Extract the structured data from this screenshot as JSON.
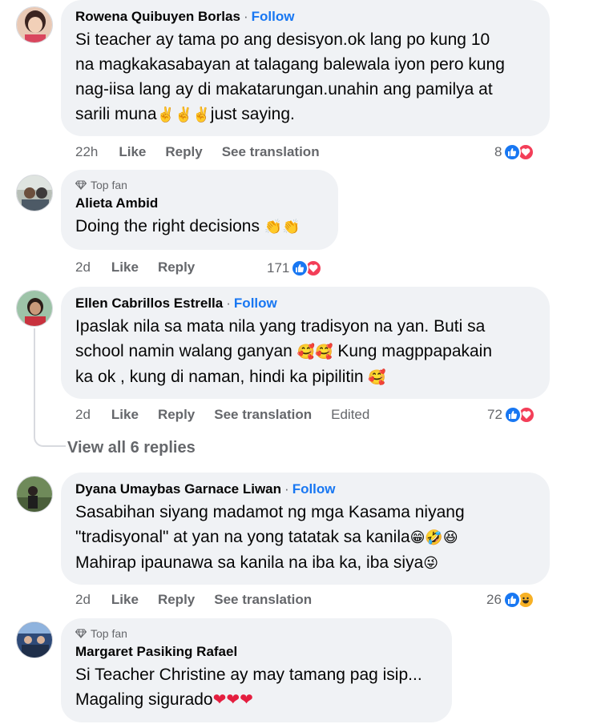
{
  "comments": [
    {
      "name": "Rowena Quibuyen Borlas",
      "follow": "Follow",
      "top_fan": "",
      "lines": [
        "Si teacher ay tama po ang desisyon.ok lang po kung 10",
        "na magkakasabayan at talagang balewala iyon pero kung",
        "nag-iisa lang ay di makatarungan.unahin ang pamilya at",
        "sarili muna"
      ],
      "text_suffix": "just saying.",
      "time": "22h",
      "like": "Like",
      "reply": "Reply",
      "translate": "See translation",
      "reaction_count": "8"
    },
    {
      "name": "Alieta Ambid",
      "follow": "",
      "top_fan": "Top fan",
      "lines": [
        "Doing the right decisions"
      ],
      "time": "2d",
      "like": "Like",
      "reply": "Reply",
      "reaction_count": "171"
    },
    {
      "name": "Ellen Cabrillos Estrella",
      "follow": "Follow",
      "top_fan": "",
      "lines": [
        "Ipaslak nila sa mata nila yang tradisyon na yan. Buti sa",
        "school namin walang ganyan",
        "ka ok , kung di naman, hindi ka pipilitin"
      ],
      "line2_suffix": "Kung magppapakain",
      "time": "2d",
      "like": "Like",
      "reply": "Reply",
      "translate": "See translation",
      "edited": "Edited",
      "reaction_count": "72",
      "view_replies": "View all 6 replies"
    },
    {
      "name": "Dyana Umaybas Garnace Liwan",
      "follow": "Follow",
      "top_fan": "",
      "lines": [
        "Sasabihan siyang madamot ng mga Kasama niyang",
        "\"tradisyonal\" at yan na yong tatatak sa kanila",
        "Mahirap ipaunawa sa kanila na iba ka, iba siya"
      ],
      "time": "2d",
      "like": "Like",
      "reply": "Reply",
      "translate": "See translation",
      "reaction_count": "26"
    },
    {
      "name": "Margaret Pasiking Rafael",
      "follow": "",
      "top_fan": "Top fan",
      "lines": [
        "Si Teacher Christine ay may tamang pag isip...",
        "Magaling sigurado"
      ]
    }
  ],
  "separator": "·",
  "colors": {
    "accent": "#1877f2",
    "bubble": "#f0f2f5",
    "muted": "#65676b",
    "love": "#f33e58",
    "haha": "#f7b125"
  },
  "icons": [
    "victory-hand-emoji",
    "clapping-hands-emoji",
    "smiling-face-with-hearts-emoji",
    "grinning-face-emoji",
    "rolling-laughing-emoji",
    "winking-tongue-emoji",
    "red-heart-emoji",
    "like-reaction-icon",
    "love-reaction-icon",
    "haha-reaction-icon",
    "diamond-icon"
  ]
}
